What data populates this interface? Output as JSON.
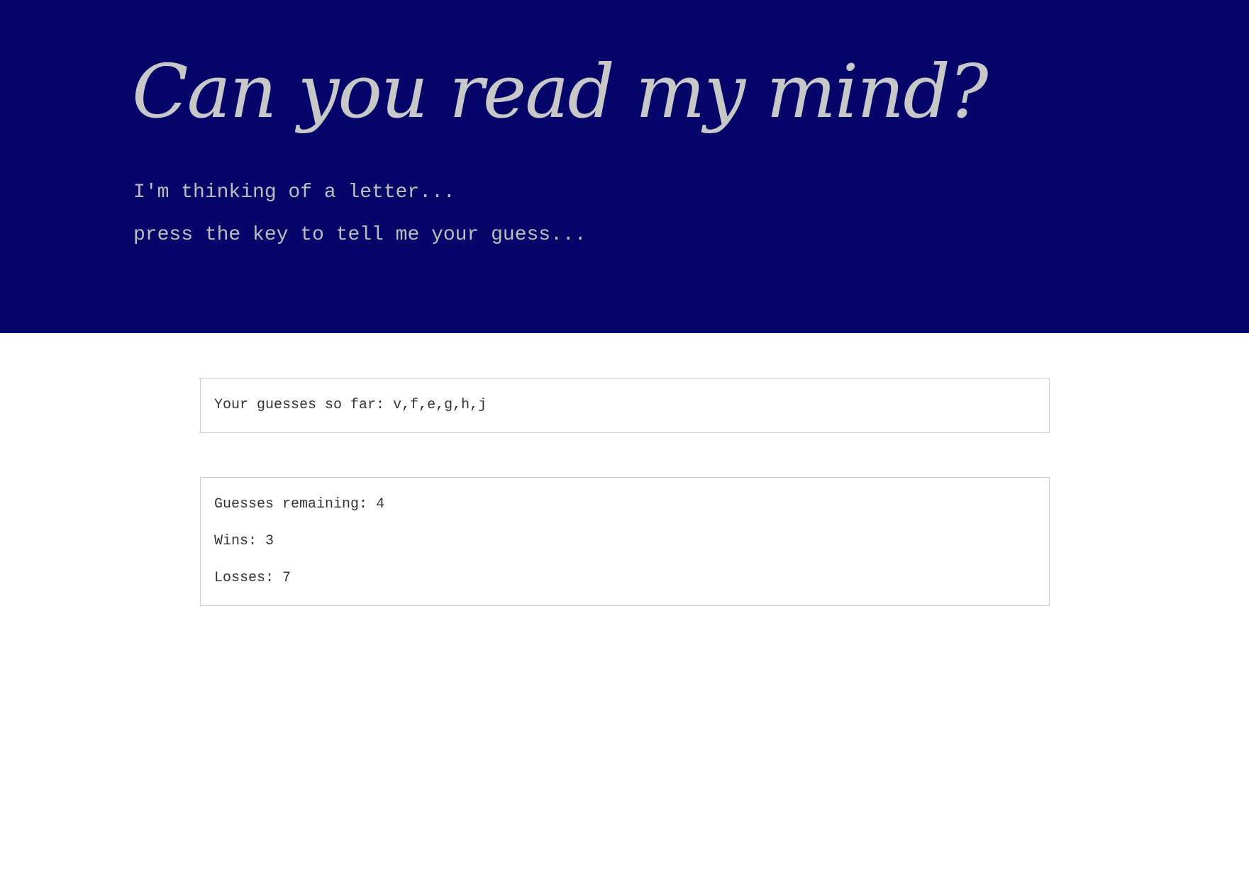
{
  "header": {
    "title": "Can you read my mind?",
    "line1": "I'm thinking of a letter...",
    "line2": "press the key to tell me your guess..."
  },
  "guesses": {
    "label": "Your guesses so far:",
    "value": "v,f,e,g,h,j"
  },
  "stats": {
    "remaining_label": "Guesses remaining:",
    "remaining_value": "4",
    "wins_label": "Wins:",
    "wins_value": "3",
    "losses_label": "Losses:",
    "losses_value": "7"
  },
  "colors": {
    "header_bg": "#06066a",
    "header_text": "#c8c8c8",
    "panel_border": "#cccccc"
  }
}
